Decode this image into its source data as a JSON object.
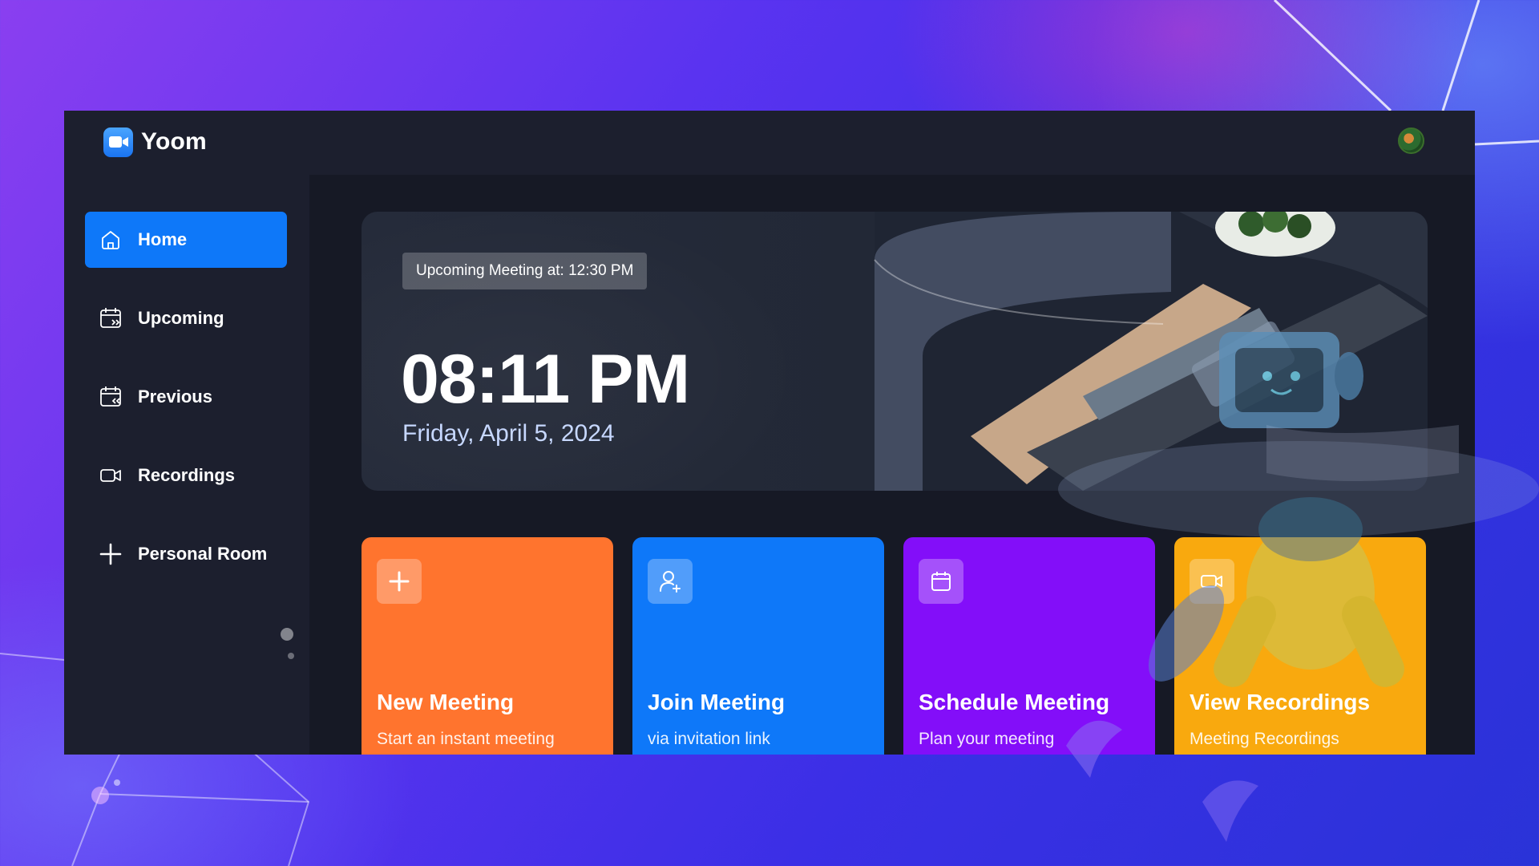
{
  "app": {
    "name": "Yoom"
  },
  "sidebar": {
    "items": [
      {
        "label": "Home",
        "icon": "home-icon",
        "active": true
      },
      {
        "label": "Upcoming",
        "icon": "calendar-upcoming-icon",
        "active": false
      },
      {
        "label": "Previous",
        "icon": "calendar-previous-icon",
        "active": false
      },
      {
        "label": "Recordings",
        "icon": "video-icon",
        "active": false
      },
      {
        "label": "Personal Room",
        "icon": "plus-icon",
        "active": false
      }
    ]
  },
  "hero": {
    "upcoming_label": "Upcoming Meeting at: 12:30 PM",
    "time": "08:11 PM",
    "date": "Friday, April 5, 2024"
  },
  "cards": [
    {
      "title": "New Meeting",
      "subtitle": "Start an instant meeting",
      "icon": "plus-icon",
      "color": "#ff742e"
    },
    {
      "title": "Join Meeting",
      "subtitle": "via invitation link",
      "icon": "add-user-icon",
      "color": "#0e78f9"
    },
    {
      "title": "Schedule Meeting",
      "subtitle": "Plan your meeting",
      "icon": "calendar-icon",
      "color": "#830ef9"
    },
    {
      "title": "View Recordings",
      "subtitle": "Meeting Recordings",
      "icon": "video-icon",
      "color": "#f9a90e"
    }
  ],
  "colors": {
    "window_bg": "#1c1f2e",
    "main_bg": "#161925",
    "accent": "#0e78f9"
  }
}
